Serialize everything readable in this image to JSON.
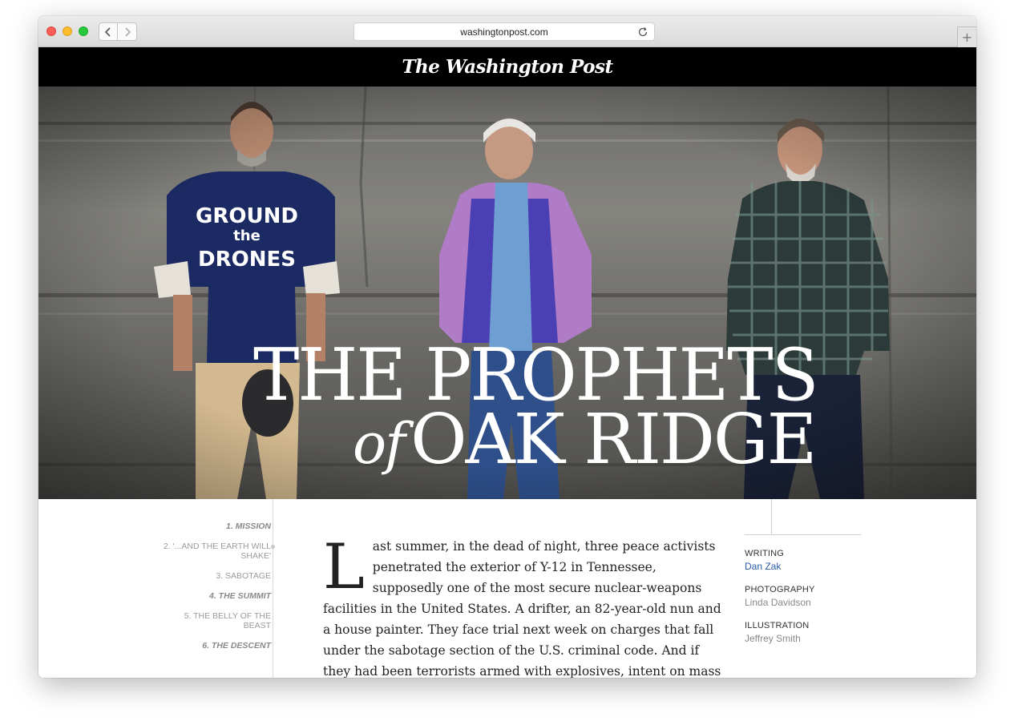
{
  "browser": {
    "url": "washingtonpost.com",
    "new_tab_label": "+",
    "back_icon": "chevron-left-icon",
    "forward_icon": "chevron-right-icon",
    "reload_icon": "reload-icon"
  },
  "site": {
    "logo_text": "The Washington Post"
  },
  "hero": {
    "title_line1": "THE PROPHETS",
    "title_of": "of",
    "title_line2": "OAK RIDGE",
    "shirt_text": "GROUND the DRONES"
  },
  "toc": {
    "items": [
      {
        "label": "1. MISSION",
        "active": true
      },
      {
        "label": "2. '...AND THE EARTH WILL SHAKE'",
        "active": false
      },
      {
        "label": "3. SABOTAGE",
        "active": false
      },
      {
        "label": "4. THE SUMMIT",
        "active": true
      },
      {
        "label": "5. THE BELLY OF THE BEAST",
        "active": false
      },
      {
        "label": "6. THE DESCENT",
        "active": true
      }
    ]
  },
  "article": {
    "drop_cap": "L",
    "body": "ast summer, in the dead of night, three peace activists penetrated the exterior of Y-12 in Tennessee, supposedly one of the most secure nuclear-weapons facilities in the United States. A drifter, an 82-year-old nun and a house painter. They face trial next week on charges that fall under the sabotage section of the U.S. criminal code. And if they had been terrorists armed with explosives, intent on mass destruction? That nightmare scenario"
  },
  "credits": {
    "writing_label": "WRITING",
    "writing_value": "Dan Zak",
    "photography_label": "PHOTOGRAPHY",
    "photography_value": "Linda Davidson",
    "illustration_label": "ILLUSTRATION",
    "illustration_value": "Jeffrey Smith"
  },
  "colors": {
    "masthead": "#000000",
    "link": "#2a5aa8",
    "toc_text": "#9a9a9a"
  }
}
